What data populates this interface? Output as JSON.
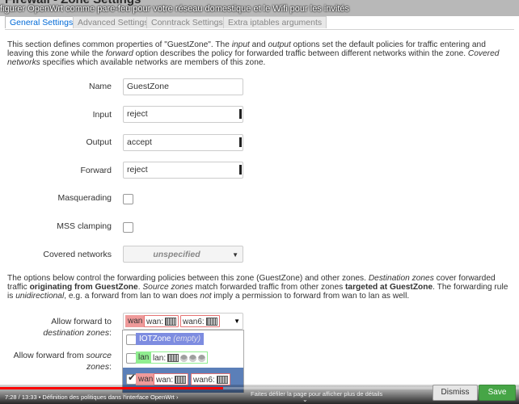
{
  "page": {
    "heading": "Firewall - Zone Settings",
    "video_title": "figurer OpenWrt comme pare-feu pour votre réseau domestique et le Wifi pour les invités"
  },
  "tabs": [
    "General Settings",
    "Advanced Settings",
    "Conntrack Settings",
    "Extra iptables arguments"
  ],
  "intro": {
    "p1": "This section defines common properties of \"GuestZone\". The ",
    "input": "input",
    "p2": " and ",
    "output": "output",
    "p3": " options set the default policies for traffic entering and leaving this zone while the ",
    "forward": "forward",
    "p4": " option describes the policy for forwarded traffic between different networks within the zone. ",
    "covered": "Covered networks",
    "p5": " specifies which available networks are members of this zone."
  },
  "form": {
    "name_label": "Name",
    "name_value": "GuestZone",
    "input_label": "Input",
    "input_value": "reject",
    "output_label": "Output",
    "output_value": "accept",
    "forward_label": "Forward",
    "forward_value": "reject",
    "masq_label": "Masquerading",
    "mss_label": "MSS clamping",
    "covered_label": "Covered networks",
    "covered_value": "unspecified"
  },
  "forward_desc": {
    "a": "The options below control the forwarding policies between this zone (GuestZone) and other zones. ",
    "b": "Destination zones",
    "c": " cover forwarded traffic ",
    "d": "originating from GuestZone",
    "e": ". ",
    "f": "Source zones",
    "g": " match forwarded traffic from other zones ",
    "h": "targeted at GuestZone",
    "i": ". The forwarding rule is ",
    "j": "unidirectional",
    "k": ", e.g. a forward from lan to wan does ",
    "l": "not",
    "m": " imply a permission to forward from wan to lan as well."
  },
  "fwd": {
    "dest_label_a": "Allow forward to ",
    "dest_label_b": "destination zones",
    "dest_label_c": ":",
    "src_label_a": "Allow forward from ",
    "src_label_b": "source zones",
    "src_label_c": ":",
    "chip_wan": "wan",
    "chip_wan_dev": "wan:",
    "chip_wan6_dev": "wan6:",
    "opt_iot": "IOTZone",
    "opt_iot_empty": "(empty)",
    "opt_lan": "lan",
    "opt_lan_dev": "lan:",
    "opt_wan": "wan",
    "opt_wan_dev": "wan:",
    "opt_wan6_dev": "wan6:"
  },
  "player": {
    "time": "7:28 / 13:33",
    "chapter": "• Définition des politiques dans l'interface OpenWrt ›",
    "scroll_hint": "Faites défiler la page pour afficher plus de détails",
    "progress": 0.43
  },
  "actions": {
    "dismiss": "Dismiss",
    "save": "Save"
  },
  "colors": {
    "accent": "#0069d6",
    "zone_wan": "#ef9a9a",
    "zone_iot": "#7d8ce0",
    "zone_lan": "#90ee90",
    "save": "#46a546",
    "progress": "#ff0000"
  }
}
